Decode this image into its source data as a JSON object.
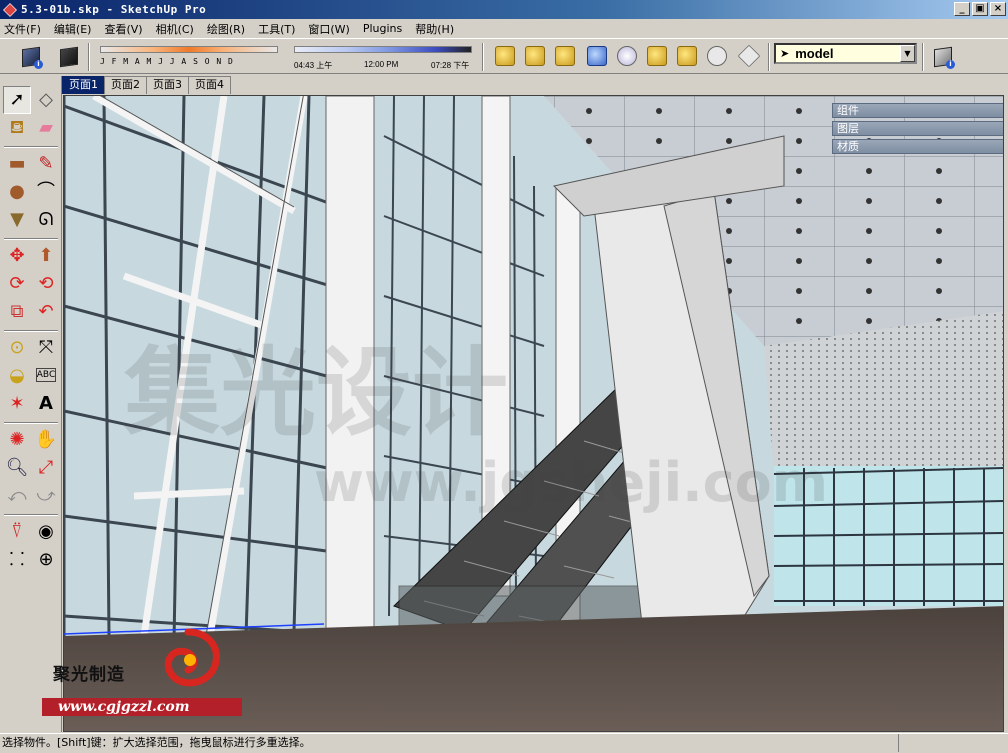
{
  "window": {
    "title": "5.3-01b.skp - SketchUp Pro",
    "min_label": "_",
    "max_label": "▣",
    "close_label": "×"
  },
  "menu": [
    "文件(F)",
    "编辑(E)",
    "查看(V)",
    "相机(C)",
    "绘图(R)",
    "工具(T)",
    "窗口(W)",
    "Plugins",
    "帮助(H)"
  ],
  "shadow": {
    "months": "J F M A M J J A S O N D",
    "time_start": "04:43 上午",
    "time_mid": "12:00 PM",
    "time_end": "07:28 下午"
  },
  "layer": {
    "selected": "model"
  },
  "scene_tabs": [
    "页面1",
    "页面2",
    "页面3",
    "页面4"
  ],
  "active_tab": 0,
  "trays": [
    "组件",
    "图层",
    "材质"
  ],
  "logo": {
    "brand": "聚光制造",
    "site": "www.cgjgzzl.com",
    "sub": "G"
  },
  "watermark": {
    "big": "集光设计",
    "small": "www.jgsheji.com"
  },
  "status": {
    "text": "选择物件。[Shift]键：扩大选择范围，拖曳鼠标进行多重选择。"
  },
  "colors": {
    "titlebar": "#0a246a",
    "floor": "#5b514b",
    "glass": "#c7d9df",
    "logo_red": "#b4202a"
  }
}
